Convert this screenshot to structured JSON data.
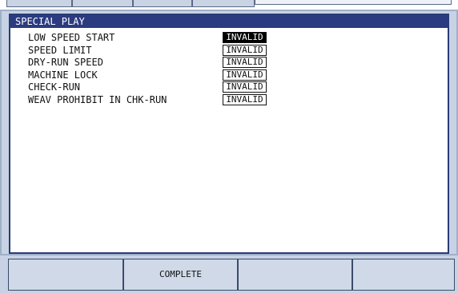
{
  "window": {
    "title": "SPECIAL PLAY"
  },
  "settings": [
    {
      "label": "LOW SPEED START",
      "value": "INVALID",
      "selected": true
    },
    {
      "label": "SPEED LIMIT",
      "value": "INVALID",
      "selected": false
    },
    {
      "label": "DRY-RUN SPEED",
      "value": "INVALID",
      "selected": false
    },
    {
      "label": "MACHINE LOCK",
      "value": "INVALID",
      "selected": false
    },
    {
      "label": "CHECK-RUN",
      "value": "INVALID",
      "selected": false
    },
    {
      "label": "WEAV PROHIBIT IN CHK-RUN",
      "value": "INVALID",
      "selected": false
    }
  ],
  "function_keys": [
    "",
    "COMPLETE",
    "",
    ""
  ],
  "colors": {
    "title_bar": "#2b3b80",
    "frame": "#c7d3e4",
    "selected_value_bg": "#000000"
  }
}
